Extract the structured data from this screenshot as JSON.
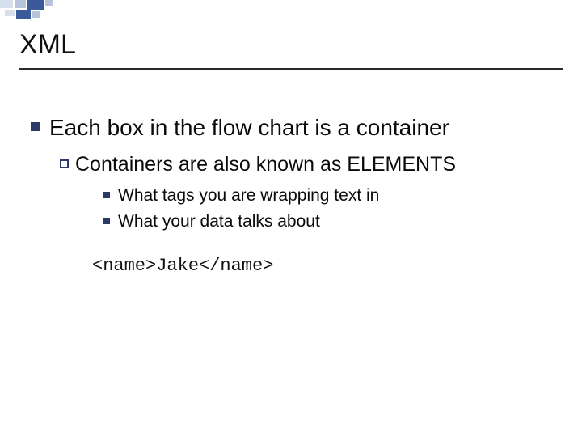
{
  "title": "XML",
  "bullets": {
    "level1": "Each box in the flow chart is a container",
    "level2": "Containers are also known as ELEMENTS",
    "level3a": "What tags you are wrapping text in",
    "level3b": "What your data talks about"
  },
  "code_example": "<name>Jake</name>"
}
